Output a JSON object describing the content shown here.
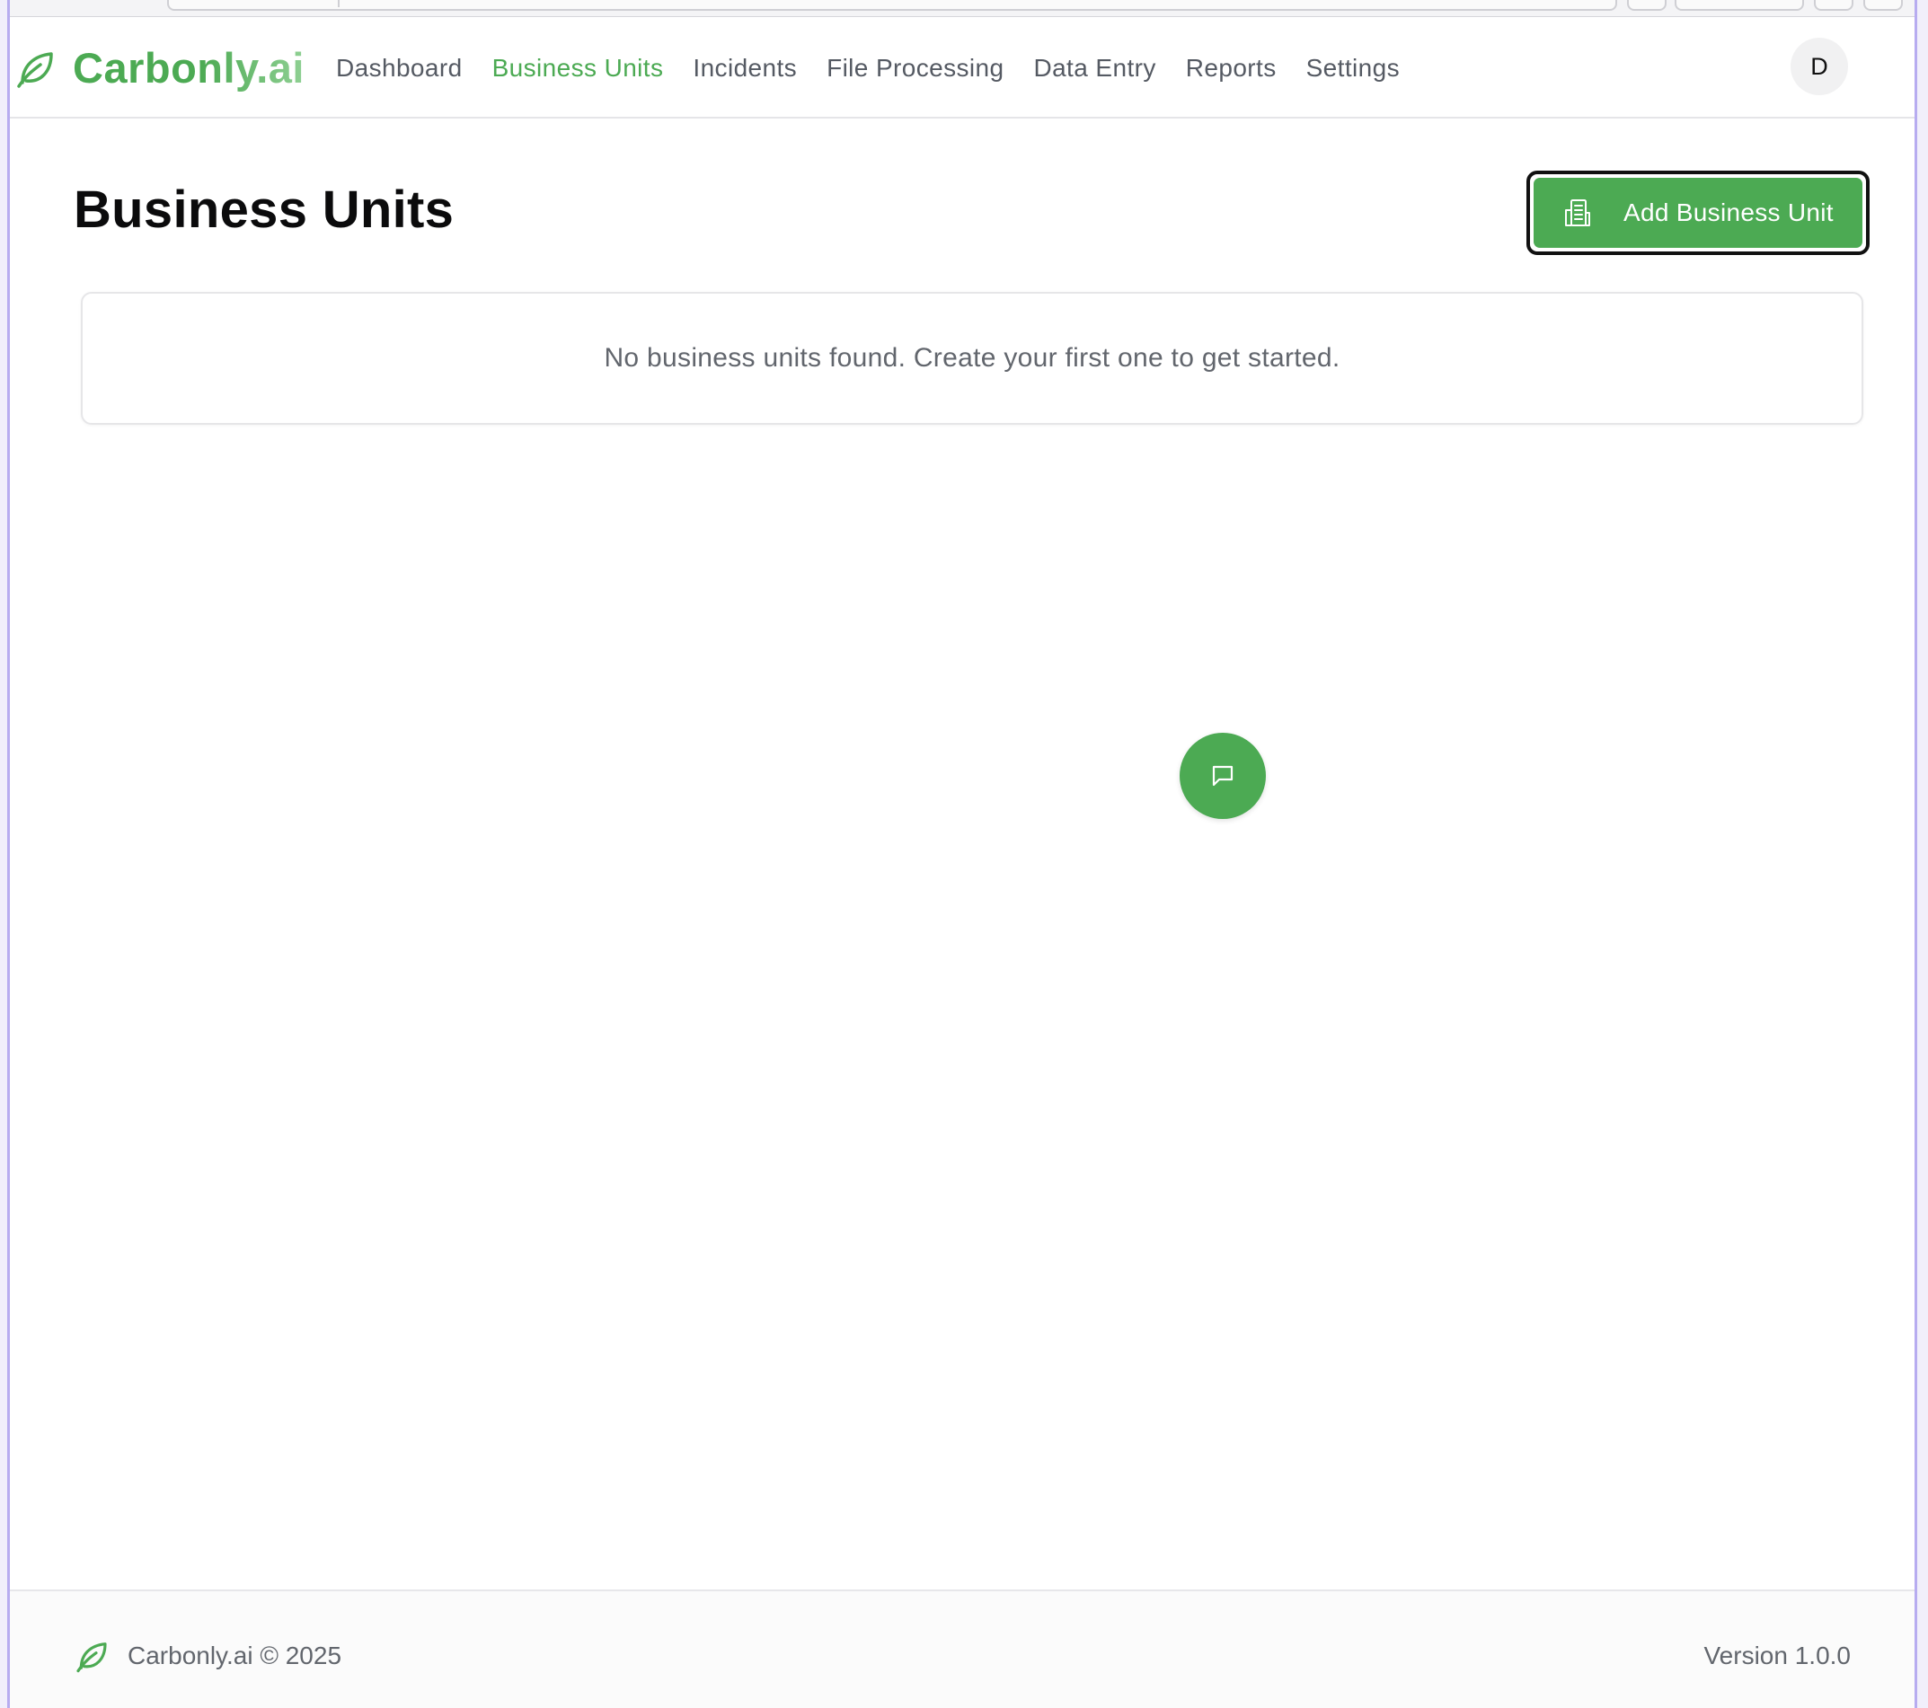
{
  "app": {
    "name": "Carbonly.ai",
    "accent_color": "#4caa53"
  },
  "header": {
    "logo_icon": "leaf-icon",
    "nav": [
      {
        "label": "Dashboard",
        "active": false
      },
      {
        "label": "Business Units",
        "active": true
      },
      {
        "label": "Incidents",
        "active": false
      },
      {
        "label": "File Processing",
        "active": false
      },
      {
        "label": "Data Entry",
        "active": false
      },
      {
        "label": "Reports",
        "active": false
      },
      {
        "label": "Settings",
        "active": false
      }
    ],
    "avatar_initial": "D"
  },
  "main": {
    "title": "Business Units",
    "add_button": {
      "label": "Add Business Unit",
      "icon": "building-icon"
    },
    "empty_message": "No business units found. Create your first one to get started.",
    "chat_button_icon": "chat-bubble-icon"
  },
  "footer": {
    "copyright": "Carbonly.ai © 2025",
    "version": "Version 1.0.0",
    "icon": "leaf-icon"
  }
}
